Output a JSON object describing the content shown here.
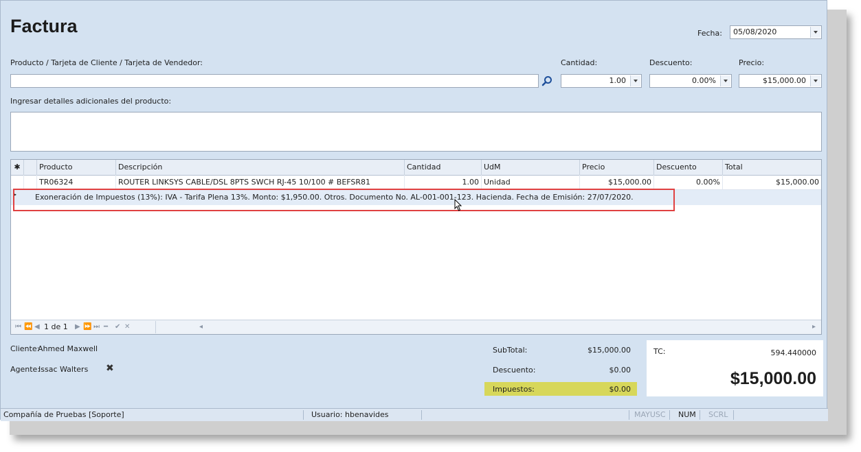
{
  "window": {
    "title": "Factura",
    "fecha_label": "Fecha:",
    "fecha_value": "05/08/2020"
  },
  "product": {
    "label": "Producto / Tarjeta de Cliente / Tarjeta de Vendedor:",
    "value": "",
    "cantidad_label": "Cantidad:",
    "cantidad_value": "1.00",
    "descuento_label": "Descuento:",
    "descuento_value": "0.00%",
    "precio_label": "Precio:",
    "precio_value": "$15,000.00",
    "details_label": "Ingresar detalles adicionales del producto:"
  },
  "grid": {
    "columns": [
      "Producto",
      "Descripción",
      "Cantidad",
      "UdM",
      "Precio",
      "Descuento",
      "Total"
    ],
    "rows": [
      [
        "TR06324",
        "ROUTER LINKSYS CABLE/DSL 8PTS SWCH RJ-45 10/100 # BEFSR81",
        "1.00",
        "Unidad",
        "$15,000.00",
        "0.00%",
        "$15,000.00"
      ]
    ],
    "exoneration": "Exoneración de Impuestos (13%): IVA - Tarifa Plena 13%. Monto: $1,950.00. Otros. Documento No. AL-001-001-123. Hacienda. Fecha de Emisión: 27/07/2020.",
    "pager": "1 de 1"
  },
  "client": {
    "cliente_label": "Cliente:",
    "cliente_value": "Ahmed Maxwell",
    "agente_label": "Agente:",
    "agente_value": "Issac Walters"
  },
  "totals": {
    "subtotal_label": "SubTotal:",
    "subtotal_value": "$15,000.00",
    "descuento_label": "Descuento:",
    "descuento_value": "$0.00",
    "impuestos_label": "Impuestos:",
    "impuestos_value": "$0.00",
    "tc_label": "TC:",
    "tc_value": "594.440000",
    "grand_total": "$15,000.00"
  },
  "status": {
    "company": "Compañía de Pruebas [Soporte]",
    "user": "Usuario: hbenavides",
    "mayusc": "MAYUSC",
    "num": "NUM",
    "scrl": "SCRL"
  },
  "colors": {
    "window_bg": "#d4e2f1",
    "highlight_border": "#e04040",
    "tax_highlight": "#d7d75a"
  }
}
